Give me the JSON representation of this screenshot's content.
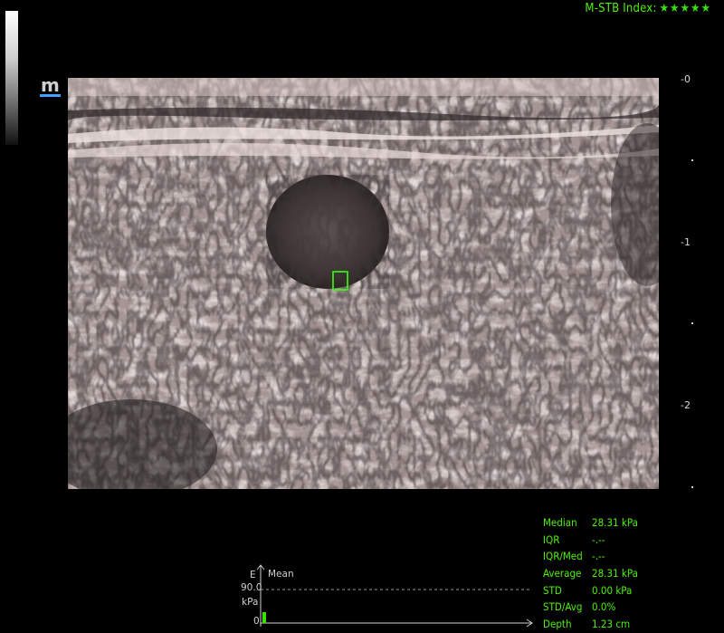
{
  "header": {
    "stb_label": "M-STB Index:",
    "stb_stars": "★★★★★",
    "logo": "m"
  },
  "depth_scale": {
    "ticks": [
      "0",
      "1",
      "2"
    ]
  },
  "measurements": [
    {
      "label": "Median",
      "value": "28.31 kPa"
    },
    {
      "label": "IQR",
      "value": "-.--"
    },
    {
      "label": "IQR/Med",
      "value": "-.--"
    },
    {
      "label": "Average",
      "value": "28.31 kPa"
    },
    {
      "label": "STD",
      "value": "0.00 kPa"
    },
    {
      "label": "STD/Avg",
      "value": "0.0%"
    },
    {
      "label": "Depth",
      "value": "1.23 cm"
    }
  ],
  "trend": {
    "axis_e": "E",
    "mean_label": "Mean",
    "max_value": "90.0",
    "unit": "kPa",
    "zero": "0"
  },
  "colors": {
    "readout_green": "#4ef000",
    "roi_box": "#39ff14"
  }
}
